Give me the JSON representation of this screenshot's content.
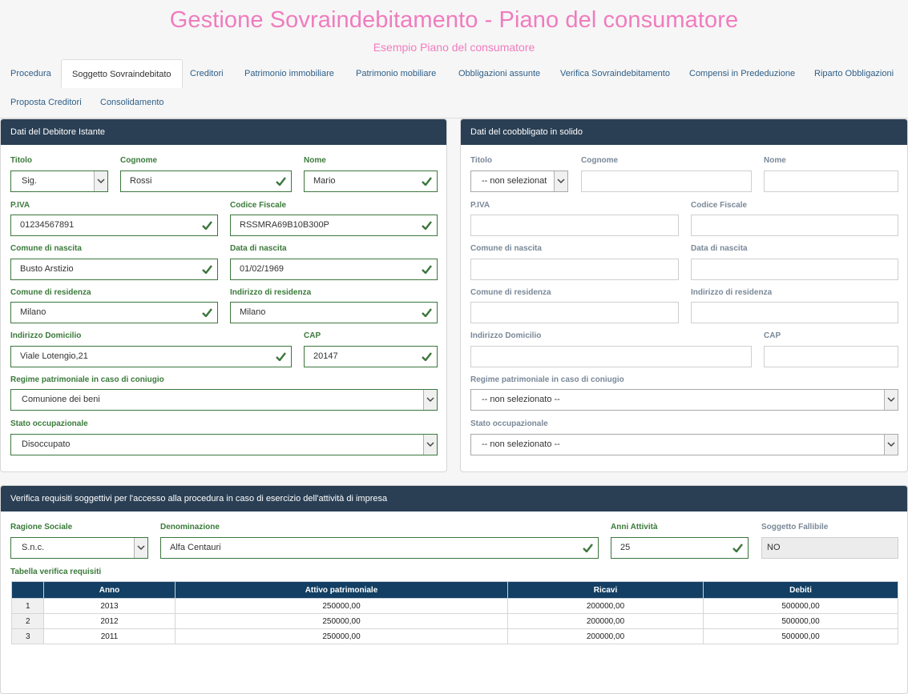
{
  "header": {
    "title": "Gestione Sovraindebitamento - Piano del consumatore",
    "subtitle": "Esempio Piano del consumatore"
  },
  "tabs": [
    {
      "label": "Procedura",
      "active": false
    },
    {
      "label": "Soggetto Sovraindebitato",
      "active": true
    },
    {
      "label": "Creditori",
      "active": false
    },
    {
      "label": "Patrimonio immobiliare",
      "active": false
    },
    {
      "label": "Patrimonio mobiliare",
      "active": false
    },
    {
      "label": "Obbligazioni assunte",
      "active": false
    },
    {
      "label": "Verifica Sovraindebitamento",
      "active": false
    },
    {
      "label": "Compensi in Prededuzione",
      "active": false
    },
    {
      "label": "Riparto Obbligazioni",
      "active": false
    },
    {
      "label": "Proposta Creditori",
      "active": false
    },
    {
      "label": "Consolidamento",
      "active": false
    }
  ],
  "debitore": {
    "heading": "Dati del Debitore Istante",
    "titolo": {
      "label": "Titolo",
      "value": "Sig."
    },
    "cognome": {
      "label": "Cognome",
      "value": "Rossi"
    },
    "nome": {
      "label": "Nome",
      "value": "Mario"
    },
    "piva": {
      "label": "P.IVA",
      "value": "01234567891"
    },
    "codice_fiscale": {
      "label": "Codice Fiscale",
      "value": "RSSMRA69B10B300P"
    },
    "comune_nascita": {
      "label": "Comune di nascita",
      "value": "Busto Arstizio"
    },
    "data_nascita": {
      "label": "Data di nascita",
      "value": "01/02/1969"
    },
    "comune_residenza": {
      "label": "Comune di residenza",
      "value": "Milano"
    },
    "indirizzo_residenza": {
      "label": "Indirizzo di residenza",
      "value": "Milano"
    },
    "indirizzo_domicilio": {
      "label": "Indirizzo Domicilio",
      "value": "Viale Lotengio,21"
    },
    "cap": {
      "label": "CAP",
      "value": "20147"
    },
    "regime": {
      "label": "Regime patrimoniale in caso di coniugio",
      "value": "Comunione dei beni"
    },
    "stato": {
      "label": "Stato occupazionale",
      "value": "Disoccupato"
    }
  },
  "coobbligato": {
    "heading": "Dati del coobbligato in solido",
    "titolo": {
      "label": "Titolo",
      "value": "-- non selezionat"
    },
    "cognome": {
      "label": "Cognome"
    },
    "nome": {
      "label": "Nome"
    },
    "piva": {
      "label": "P.IVA"
    },
    "codice_fiscale": {
      "label": "Codice Fiscale"
    },
    "comune_nascita": {
      "label": "Comune di nascita"
    },
    "data_nascita": {
      "label": "Data di nascita"
    },
    "comune_residenza": {
      "label": "Comune di residenza"
    },
    "indirizzo_residenza": {
      "label": "Indirizzo di residenza"
    },
    "indirizzo_domicilio": {
      "label": "Indirizzo Domicilio"
    },
    "cap": {
      "label": "CAP"
    },
    "regime": {
      "label": "Regime patrimoniale in caso di coniugio",
      "value": "-- non selezionato --"
    },
    "stato": {
      "label": "Stato occupazionale",
      "value": "-- non selezionato --"
    }
  },
  "verifica": {
    "heading": "Verifica requisiti soggettivi per l'accesso alla procedura in caso di esercizio dell'attività di impresa",
    "ragione_sociale": {
      "label": "Ragione Sociale",
      "value": "S.n.c."
    },
    "denominazione": {
      "label": "Denominazione",
      "value": "Alfa Centauri"
    },
    "anni_attivita": {
      "label": "Anni Attività",
      "value": "25"
    },
    "soggetto_fallibile": {
      "label": "Soggetto Fallibile",
      "value": "NO"
    },
    "table_title": "Tabella verifica requisiti",
    "table": {
      "columns": [
        "",
        "Anno",
        "Attivo patrimoniale",
        "Ricavi",
        "Debiti"
      ],
      "rows": [
        [
          "1",
          "2013",
          "250000,00",
          "200000,00",
          "500000,00"
        ],
        [
          "2",
          "2012",
          "250000,00",
          "200000,00",
          "500000,00"
        ],
        [
          "3",
          "2011",
          "250000,00",
          "200000,00",
          "500000,00"
        ]
      ]
    }
  },
  "colors": {
    "title_pink": "#f07cbe",
    "panel_header": "#2a3f54",
    "table_header": "#123f63",
    "valid_green": "#3c763d"
  }
}
